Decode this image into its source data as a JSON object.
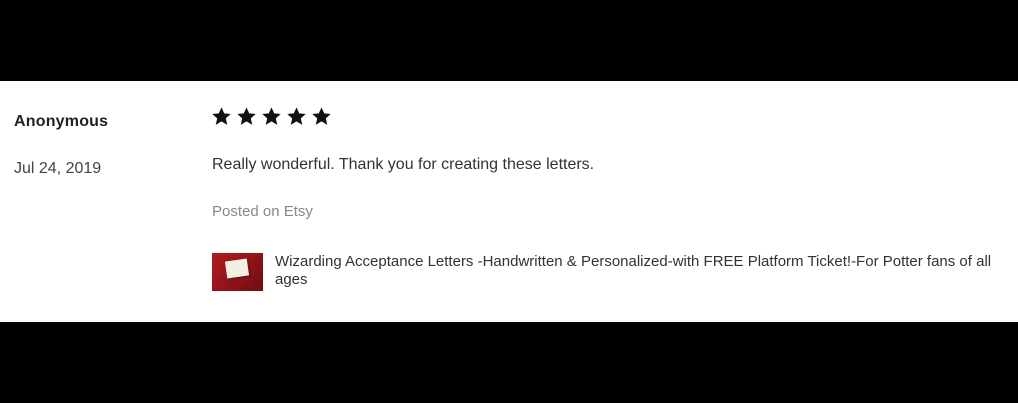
{
  "review": {
    "reviewer_name": "Anonymous",
    "date": "Jul 24, 2019",
    "rating": 5,
    "rating_max": 5,
    "text": "Really wonderful. Thank you for creating these letters.",
    "posted_on": "Posted on Etsy",
    "listing": {
      "title": "Wizarding Acceptance Letters -Handwritten & Personalized-with FREE Platform Ticket!-For Potter fans of all ages",
      "thumbnail_icon": "product-thumbnail"
    }
  },
  "colors": {
    "background_band": "#000000",
    "card": "#ffffff",
    "star": "#111111",
    "muted_text": "#888888"
  }
}
